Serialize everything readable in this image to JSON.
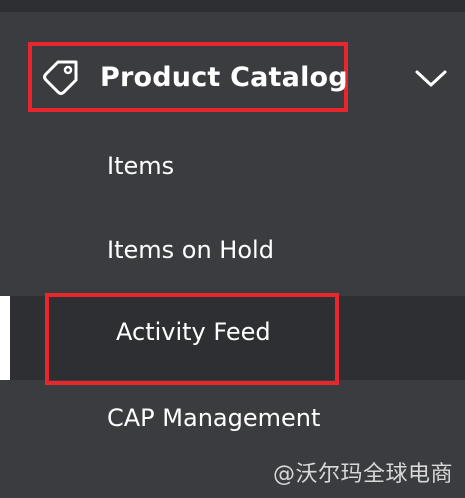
{
  "section": {
    "title": "Product Catalog",
    "icon": "tag-icon",
    "expand_icon": "chevron-down-icon"
  },
  "nav": {
    "items": [
      {
        "label": "Items"
      },
      {
        "label": "Items on Hold"
      },
      {
        "label": "Activity Feed",
        "active": true
      },
      {
        "label": "CAP Management"
      }
    ]
  },
  "watermark": "@沃尔玛全球电商",
  "colors": {
    "background": "#3b3c40",
    "active_background": "#2e2f32",
    "highlight": "#e8262d",
    "text": "#ffffff"
  }
}
